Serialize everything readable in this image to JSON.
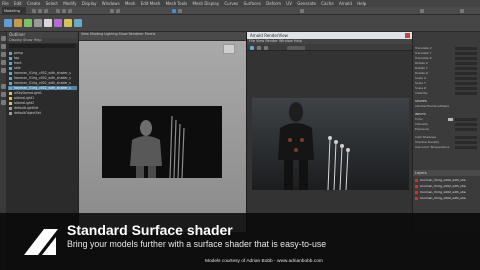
{
  "menubar": {
    "items": [
      "File",
      "Edit",
      "Create",
      "Select",
      "Modify",
      "Display",
      "Windows",
      "Mesh",
      "Edit Mesh",
      "Mesh Tools",
      "Mesh Display",
      "Curves",
      "Surfaces",
      "Deform",
      "UV",
      "Generate",
      "Cache",
      "Arnold",
      "Help"
    ]
  },
  "workspace": {
    "mode": "Modeling"
  },
  "outliner": {
    "title": "Outliner",
    "menus": "Display  Show  Help",
    "items": [
      {
        "label": "persp",
        "selected": false
      },
      {
        "label": "top",
        "selected": false
      },
      {
        "label": "front",
        "selected": false
      },
      {
        "label": "side",
        "selected": false
      },
      {
        "label": "Ironman_V1rig_v002_with_shader_s",
        "selected": false
      },
      {
        "label": "Ironman_V1rig_v002_with_shader_s",
        "selected": false
      },
      {
        "label": "Ironman_V1rig_v002_with_shader_s",
        "selected": false
      },
      {
        "label": "Ironman_V1rig_v002_with_shader_s",
        "selected": true
      },
      {
        "label": "aiSkyDomeLight1",
        "selected": false
      },
      {
        "label": "aiAreaLight1",
        "selected": false
      },
      {
        "label": "aiAreaLight2",
        "selected": false
      },
      {
        "label": "defaultLightSet",
        "selected": false
      },
      {
        "label": "defaultObjectSet",
        "selected": false
      }
    ]
  },
  "viewport": {
    "menus": "View  Shading  Lighting  Show  Renderer  Panels"
  },
  "render_view": {
    "title": "Arnold RenderView",
    "menus": "File  View  Render  Window  Help"
  },
  "attribute_editor": {
    "rows": [
      "Translate X",
      "Translate Y",
      "Translate Z",
      "Rotate X",
      "Rotate Y",
      "Rotate Z",
      "Scale X",
      "Scale Y",
      "Scale Z",
      "Visibility",
      "",
      "SHAPES",
      "standardSurfaceShape",
      "",
      "INPUTS",
      "Color",
      "Intensity",
      "Exposure",
      "",
      "Cast Shadows",
      "Shadow Density",
      "Use Color Temperature"
    ],
    "layers_tab": "Layers",
    "layers": [
      "Ironman_V1rig_v002_with_sha",
      "Ironman_V1rig_v002_with_sha",
      "Ironman_V1rig_v002_with_sha",
      "Ironman_V1rig_v002_with_sha"
    ]
  },
  "overlay": {
    "title": "Standard Surface shader",
    "subtitle": "Bring your models further with a surface shader that is easy-to-use",
    "credit": "Models courtesy of Adrian Bobb - www.adrianbobb.com"
  },
  "colors": {
    "selection": "#5285a6",
    "layer_red": "#d42e2e",
    "overlay_bg": "#080808"
  },
  "icons": [
    "autodesk-logo-icon",
    "render-icon",
    "camera-icon",
    "close-icon"
  ]
}
